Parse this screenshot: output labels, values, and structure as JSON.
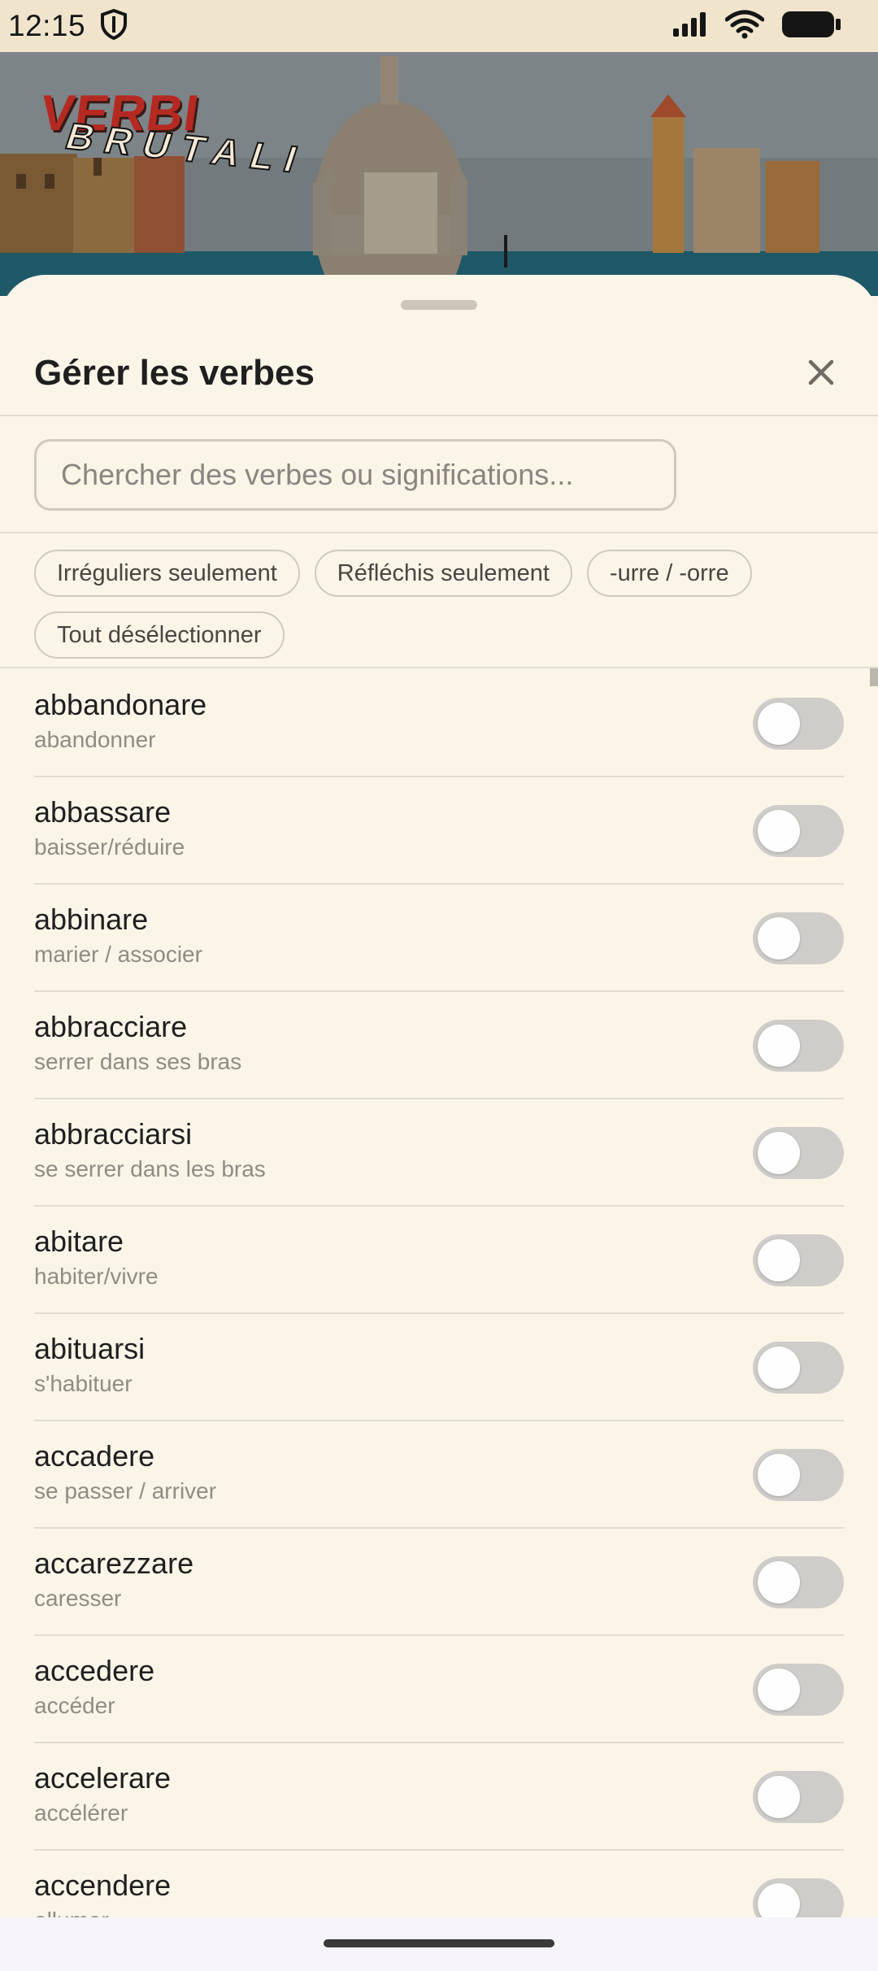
{
  "status": {
    "time": "12:15",
    "icons": [
      "shield-icon",
      "signal-icon",
      "wifi-icon",
      "battery-icon"
    ]
  },
  "app": {
    "logo_main": "VERBI",
    "logo_sub": "BRUTALI"
  },
  "sheet": {
    "title": "Gérer les verbes",
    "close_icon": "close-icon"
  },
  "search": {
    "placeholder": "Chercher des verbes ou significations...",
    "value": ""
  },
  "filters": [
    {
      "label": "Irréguliers seulement"
    },
    {
      "label": "Réfléchis seulement"
    },
    {
      "label": "-urre / -orre"
    },
    {
      "label": "Tout désélectionner"
    }
  ],
  "verbs": [
    {
      "name": "abbandonare",
      "meaning": "abandonner",
      "enabled": false
    },
    {
      "name": "abbassare",
      "meaning": "baisser/réduire",
      "enabled": false
    },
    {
      "name": "abbinare",
      "meaning": "marier / associer",
      "enabled": false
    },
    {
      "name": "abbracciare",
      "meaning": "serrer dans ses bras",
      "enabled": false
    },
    {
      "name": "abbracciarsi",
      "meaning": "se serrer dans les bras",
      "enabled": false
    },
    {
      "name": "abitare",
      "meaning": "habiter/vivre",
      "enabled": false
    },
    {
      "name": "abituarsi",
      "meaning": "s'habituer",
      "enabled": false
    },
    {
      "name": "accadere",
      "meaning": "se passer / arriver",
      "enabled": false
    },
    {
      "name": "accarezzare",
      "meaning": "caresser",
      "enabled": false
    },
    {
      "name": "accedere",
      "meaning": "accéder",
      "enabled": false
    },
    {
      "name": "accelerare",
      "meaning": "accélérer",
      "enabled": false
    },
    {
      "name": "accendere",
      "meaning": "allumer",
      "enabled": false
    }
  ],
  "colors": {
    "sheet_bg": "#fbf5e8",
    "status_bg": "#f0e4cc",
    "toggle_off": "#cfcdca",
    "logo_red": "#b42a22"
  }
}
